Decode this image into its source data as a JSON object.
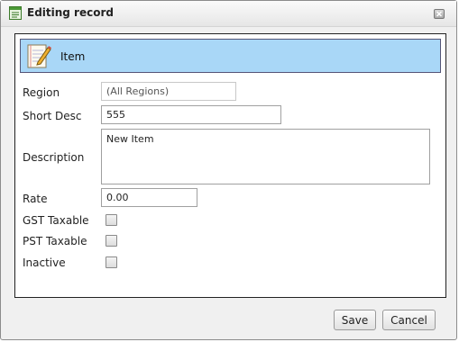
{
  "window": {
    "title": "Editing record",
    "icon": "form-window-icon"
  },
  "panel": {
    "title": "Item",
    "icon": "notepad-pencil-icon",
    "header_color": "#a9d7f7"
  },
  "fields": {
    "region": {
      "label": "Region",
      "value": "(All Regions)"
    },
    "short_desc": {
      "label": "Short Desc",
      "value": "555"
    },
    "description": {
      "label": "Description",
      "value": "New Item"
    },
    "rate": {
      "label": "Rate",
      "value": "0.00"
    }
  },
  "checkboxes": {
    "gst_taxable": {
      "label": "GST Taxable",
      "checked": false
    },
    "pst_taxable": {
      "label": "PST Taxable",
      "checked": false
    },
    "inactive": {
      "label": "Inactive",
      "checked": false
    }
  },
  "buttons": {
    "save": "Save",
    "cancel": "Cancel"
  }
}
